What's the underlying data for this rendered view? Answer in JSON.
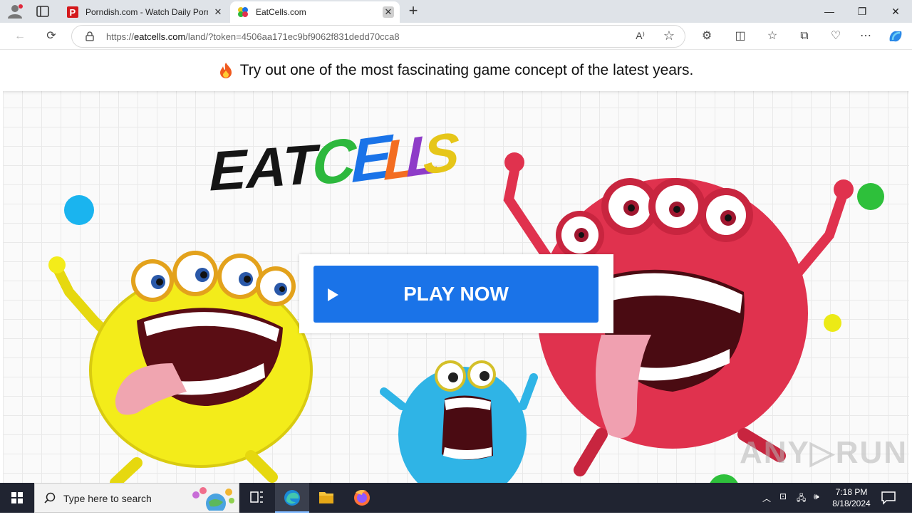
{
  "browser": {
    "tabs": [
      {
        "title": "Porndish.com - Watch Daily Porn",
        "favicon": "P",
        "active": false
      },
      {
        "title": "EatCells.com",
        "active": true
      }
    ],
    "new_tab": "+",
    "url_prefix": "https://",
    "url_host": "eatcells.com",
    "url_path": "/land/?token=4506aa171ec9bf9062f831dedd70cca8",
    "read_aloud": "A⁾",
    "window_controls": {
      "minimize": "—",
      "restore": "❐",
      "close": "✕"
    }
  },
  "page": {
    "banner_text": "Try out one of the most fascinating game concept of the latest years.",
    "logo_word1": "EAT",
    "logo_word2_letters": [
      "C",
      "E",
      "L",
      "L",
      "S"
    ],
    "logo_colors": [
      "#2db83d",
      "#1a73e8",
      "#f36d21",
      "#8e3cc8",
      "#e6c619"
    ],
    "play_button": "PLAY NOW",
    "watermark": "ANY▷RUN"
  },
  "taskbar": {
    "search_placeholder": "Type here to search",
    "time": "7:18 PM",
    "date": "8/18/2024"
  },
  "colors": {
    "accent": "#1a73e8",
    "dot_blue": "#1ab4ef",
    "dot_green": "#2ec03b",
    "dot_yellow": "#ecea16",
    "monster_yellow": "#f3ec1a",
    "monster_red": "#e0324e",
    "monster_blue": "#2fb4e6"
  }
}
